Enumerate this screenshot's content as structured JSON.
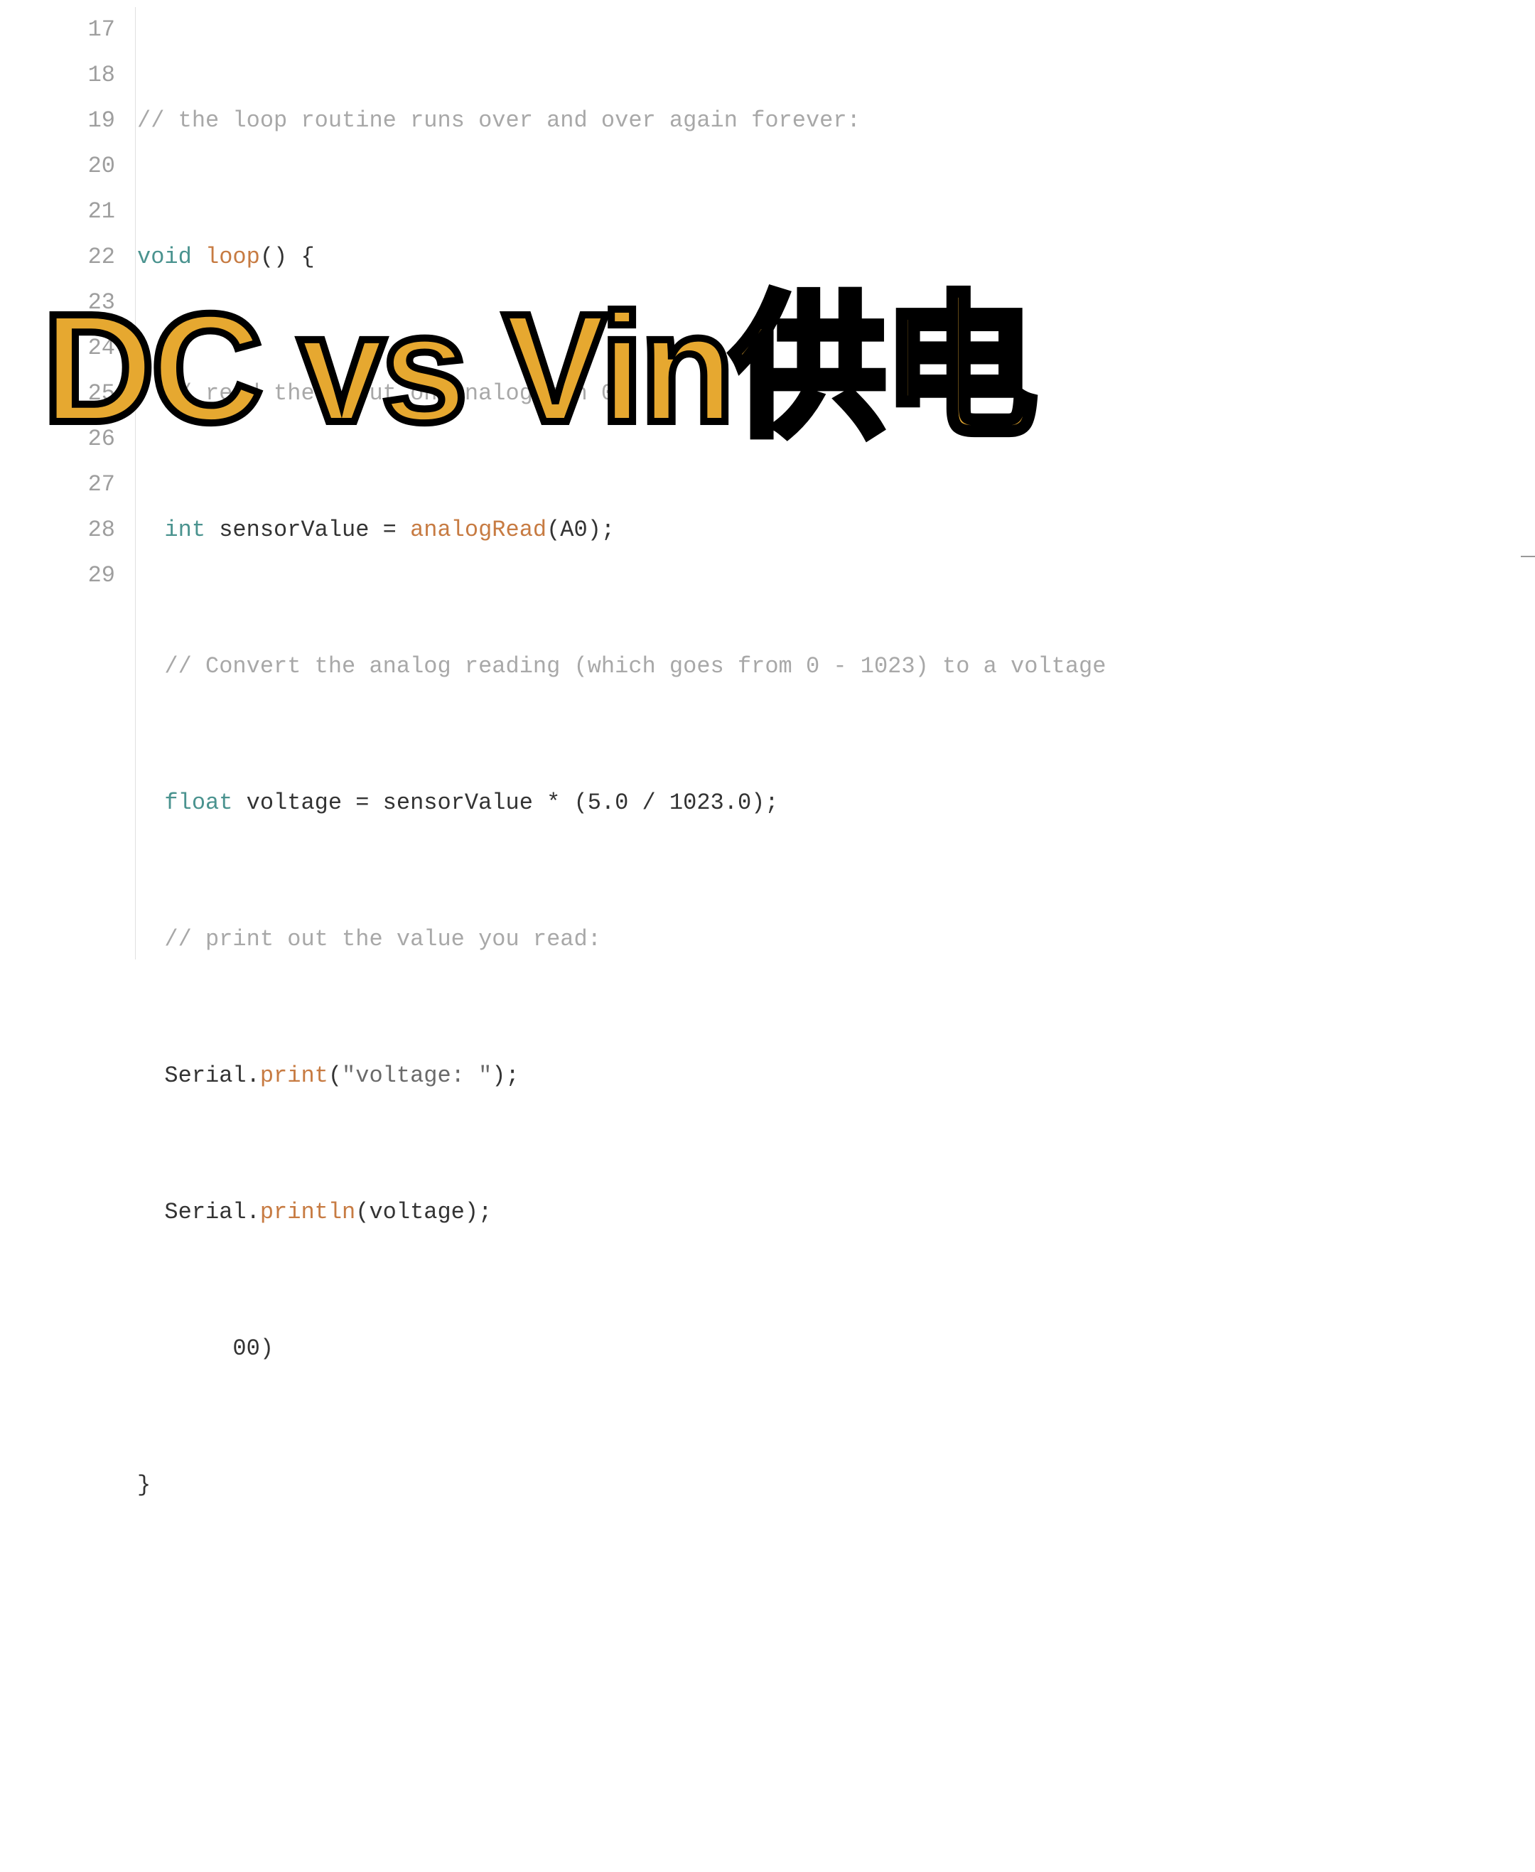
{
  "lines": [
    {
      "num": "17"
    },
    {
      "num": "18"
    },
    {
      "num": "19"
    },
    {
      "num": "20"
    },
    {
      "num": "21"
    },
    {
      "num": "22"
    },
    {
      "num": "23"
    },
    {
      "num": "24"
    },
    {
      "num": "25"
    },
    {
      "num": "26"
    },
    {
      "num": "27"
    },
    {
      "num": "28"
    },
    {
      "num": "29"
    }
  ],
  "code": {
    "l17_comment": "// the loop routine runs over and over again forever:",
    "l18_void": "void",
    "l18_loop": "loop",
    "l18_rest": "() {",
    "l19_comment": "  // read the input on analog pin 0:",
    "l20_indent": "  ",
    "l20_int": "int",
    "l20_sp1": " ",
    "l20_var": "sensorValue",
    "l20_eq": " = ",
    "l20_func": "analogRead",
    "l20_args": "(A0);",
    "l21_comment": "  // Convert the analog reading (which goes from 0 - 1023) to a voltage",
    "l22_indent": "  ",
    "l22_float": "float",
    "l22_rest": " voltage = sensorValue * (5.0 / 1023.0);",
    "l23_comment": "  // print out the value you read:",
    "l24_indent": "  ",
    "l24_serial": "Serial",
    "l24_dot": ".",
    "l24_print": "print",
    "l24_open": "(",
    "l24_str": "\"voltage: \"",
    "l24_close": ");",
    "l25_indent": "  ",
    "l25_serial": "Serial",
    "l25_dot": ".",
    "l25_println": "println",
    "l25_args": "(voltage);",
    "l26_text": "       00)",
    "l27_brace": "}"
  },
  "overlay": "DC vs Vin供电"
}
